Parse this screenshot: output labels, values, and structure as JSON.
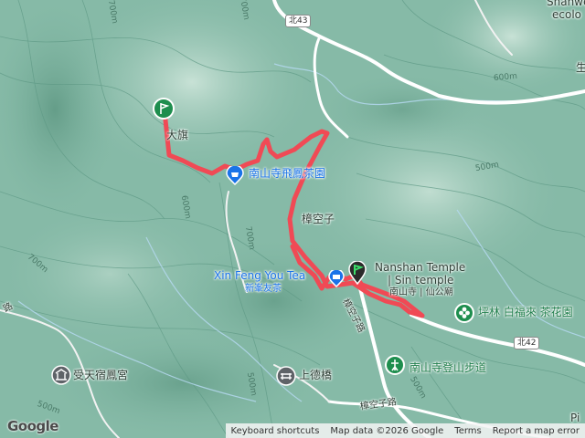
{
  "map": {
    "labels": {
      "shanwei": "Shanwe",
      "ecolo": "ecolo",
      "chi_top_right": "生",
      "qi": "大旗",
      "nanshan_tea": "南山寺飛鳳茶園",
      "zhangkongzi": "樟空子",
      "nanshan_temple_en": "Nanshan Temple",
      "sin_temple_en": "| Sin temple",
      "nanshan_temple_zh": "南山寺 | 仙公廟",
      "xinfeng_en": "Xin Feng You Tea",
      "xinfeng_zh": "新峯友茶",
      "pinglin": "坪林 白福來 茶花園",
      "trail": "南山寺登山步道",
      "shoutian": "受天宿鳳宮",
      "shangde": "上德橋",
      "road_zhangkong_1": "樟空子路",
      "road_zhangkong_2": "樟空子路",
      "pi": "Pi",
      "lu_left": "路"
    },
    "road_shields": {
      "north43": "北43",
      "north42": "北42"
    },
    "contours": {
      "c700_a": "700m",
      "c700_b": "700m",
      "c700_c": "700m",
      "c700_d": "700m",
      "c600_a": "600m",
      "c600_b": "600m",
      "c500_a": "500m",
      "c500_b": "500m",
      "c500_c": "500m",
      "c500_d": "500m"
    },
    "colors": {
      "terrain": "#7fb5a2",
      "route": "#f04a55",
      "marker_green": "#1e8e4e",
      "marker_blue": "#1a73e8",
      "road": "#e8ecee"
    }
  },
  "attribution": {
    "logo": "Google",
    "keyboard": "Keyboard shortcuts",
    "map_data": "Map data ©2026 Google",
    "terms": "Terms",
    "report": "Report a map error"
  }
}
